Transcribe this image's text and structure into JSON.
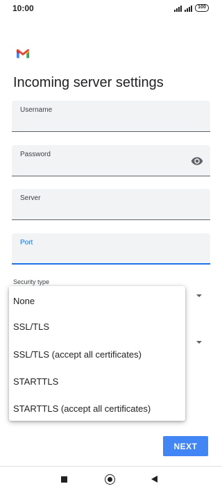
{
  "status_bar": {
    "time": "10:00",
    "battery": "100"
  },
  "page": {
    "title": "Incoming server settings"
  },
  "fields": {
    "username": {
      "label": "Username",
      "value": ""
    },
    "password": {
      "label": "Password",
      "value": ""
    },
    "server": {
      "label": "Server",
      "value": ""
    },
    "port": {
      "label": "Port",
      "value": ""
    }
  },
  "security": {
    "label": "Security type",
    "options": [
      "None",
      "SSL/TLS",
      "SSL/TLS (accept all certificates)",
      "STARTTLS",
      "STARTTLS (accept all certificates)"
    ]
  },
  "actions": {
    "next_label": "NEXT"
  },
  "colors": {
    "accent": "#1a73e8",
    "button": "#4285f4",
    "field_bg": "#f1f3f4"
  },
  "icons": {
    "logo": "gmail-logo",
    "password_toggle": "eye-icon",
    "nav": [
      "recent-apps-icon",
      "home-icon",
      "back-icon"
    ]
  }
}
